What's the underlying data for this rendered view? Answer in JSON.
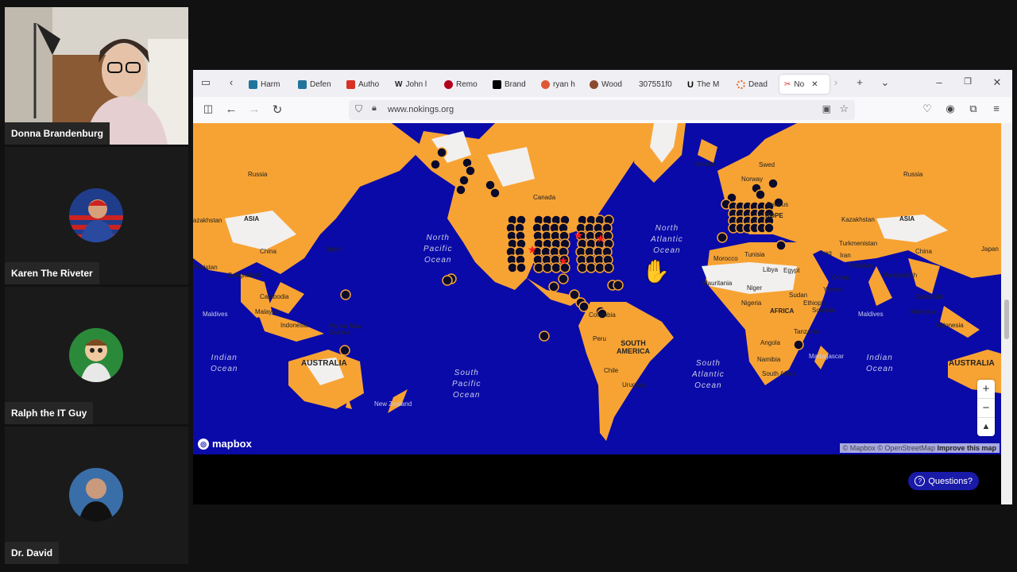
{
  "participants": [
    {
      "name": "Donna Brandenburg",
      "avatar": "webcam"
    },
    {
      "name": "Karen The Riveter",
      "avatar": "riveter-avatar"
    },
    {
      "name": "Ralph the IT Guy",
      "avatar": "cartoon-avatar"
    },
    {
      "name": "Dr. David",
      "avatar": "photo-avatar"
    }
  ],
  "tabs": [
    {
      "label": "Harm",
      "color": "#21759b"
    },
    {
      "label": "Defen",
      "color": "#21759b"
    },
    {
      "label": "Autho",
      "color": "#d93025"
    },
    {
      "label": "John l",
      "color": "#222222"
    },
    {
      "label": "Remo",
      "color": "#b3001b"
    },
    {
      "label": "Brand",
      "color": "#000000"
    },
    {
      "label": "ryan h",
      "color": "#de5833"
    },
    {
      "label": "Wood",
      "color": "#8a4b2f"
    },
    {
      "label": "307551f0",
      "color": ""
    },
    {
      "label": "The M",
      "color": "#000000"
    },
    {
      "label": "Dead",
      "color": "#e06c2a"
    },
    {
      "label": "No",
      "color": "#d93025"
    }
  ],
  "url": "www.nokings.org",
  "map": {
    "oceans": {
      "north_pacific": "North\nPacific\nOcean",
      "north_atlantic": "North\nAtlantic\nOcean",
      "south_pacific": "South\nPacific\nOcean",
      "south_atlantic": "South\nAtlantic\nOcean",
      "indian_left": "Indian\nOcean",
      "indian_right": "Indian\nOcean"
    },
    "places": {
      "russia_left": "Russia",
      "asia_left": "ASIA",
      "kazakhstan_left": "azakhstan",
      "china_left": "China",
      "japan_left": "Japan",
      "pakistan_left": "Pakistan",
      "bangladesh_left": "Bangladesh",
      "cambodia_left": "Cambodia",
      "malaysia_left": "Malaysia",
      "indonesia_left": "Indonesia",
      "maldives_left": "Maldives",
      "papua": "Papua New\nGuinea",
      "australia_left": "AUSTRALIA",
      "new_zealand": "New Zealand",
      "canada": "Canada",
      "colombia": "Colombia",
      "peru": "Peru",
      "south_america": "SOUTH\nAMERICA",
      "chile": "Chile",
      "uruguay": "Uruguay",
      "iceland": "Iceland",
      "norway": "Norway",
      "sweden": "Swed",
      "belarus": "Belarus",
      "europe": "ROPE",
      "morocco": "Morocco",
      "tunisia": "Tunisia",
      "libya": "Libya",
      "egypt": "Egypt",
      "mauritania": "Mauritania",
      "niger": "Niger",
      "nigeria": "Nigeria",
      "sudan": "Sudan",
      "africa": "AFRICA",
      "ethiopia": "Ethiopia",
      "somalia": "Somalia",
      "tanzania": "Tanzania",
      "angola": "Angola",
      "namibia": "Namibia",
      "south_africa": "South Africa",
      "madagascar": "Madagascar",
      "kazakhstan_right": "Kazakhstan",
      "russia_right": "Russia",
      "asia_right": "ASIA",
      "turkmenistan": "Turkmenistan",
      "iraq": "Iraq",
      "iran": "Iran",
      "oman": "Oman",
      "yemen": "Yemen",
      "pakistan_right": "Pakistan",
      "china_right": "China",
      "bangladesh_right": "Bangladesh",
      "japan_right": "Japan",
      "cambodia_right": "Cambodia",
      "malaysia_right": "Malaysia",
      "indonesia_right": "Indonesia",
      "maldives_right": "Maldives",
      "australia_right": "AUSTRALIA"
    },
    "logo": "mapbox",
    "attribution": "© Mapbox © OpenStreetMap",
    "improve": "Improve this map",
    "colors": {
      "ocean": "#0a0aa8",
      "land": "#f7a334",
      "marker": "#0a0a2a",
      "star": "#ff1a1a"
    }
  },
  "questions_label": "Questions?"
}
